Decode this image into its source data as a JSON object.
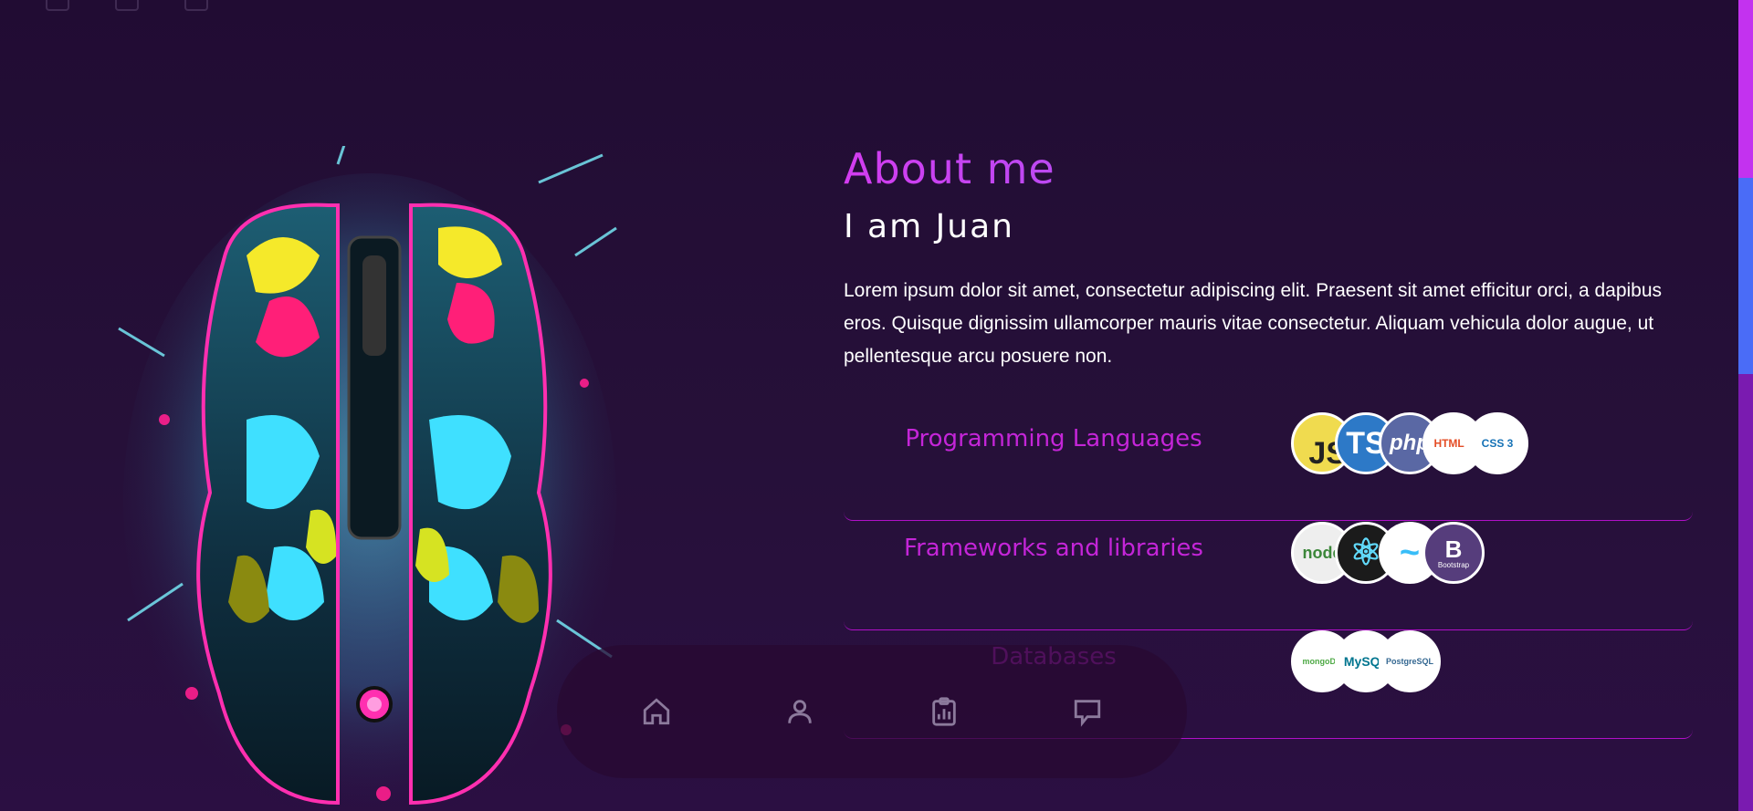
{
  "about": {
    "title": "About me",
    "subtitle": "I am Juan",
    "text": "Lorem ipsum dolor sit amet, consectetur adipiscing elit. Praesent sit amet efficitur orci, a dapibus eros. Quisque dignissim ullamcorper mauris vitae consectetur. Aliquam vehicula dolor augue, ut pellentesque arcu posuere non."
  },
  "skills": [
    {
      "label": "Programming Languages",
      "logos": [
        {
          "name": "javascript",
          "text": "JS",
          "bg": "#f0db4f",
          "fg": "#222"
        },
        {
          "name": "typescript",
          "text": "TS",
          "bg": "#2d79c7",
          "fg": "#fff"
        },
        {
          "name": "php",
          "text": "php",
          "bg": "#5a68a4",
          "fg": "#fff"
        },
        {
          "name": "html5",
          "text": "HTML 5",
          "bg": "#ffffff",
          "fg": "#e44d26"
        },
        {
          "name": "css3",
          "text": "CSS 3",
          "bg": "#ffffff",
          "fg": "#1572b6"
        }
      ]
    },
    {
      "label": "Frameworks and libraries",
      "logos": [
        {
          "name": "nodejs",
          "text": "node",
          "bg": "#eeeeee",
          "fg": "#3c873a"
        },
        {
          "name": "react",
          "text": "⚛",
          "bg": "#1b1b1b",
          "fg": "#61dafb"
        },
        {
          "name": "tailwind",
          "text": "~",
          "bg": "#ffffff",
          "fg": "#38bdf8"
        },
        {
          "name": "bootstrap",
          "text": "B",
          "bg": "#563d7c",
          "fg": "#fff",
          "caption": "Bootstrap"
        }
      ]
    },
    {
      "label": "Databases",
      "logos": [
        {
          "name": "mongodb",
          "text": "mongoDB",
          "bg": "#ffffff",
          "fg": "#4da944"
        },
        {
          "name": "mysql",
          "text": "MySQL",
          "bg": "#ffffff",
          "fg": "#00758f"
        },
        {
          "name": "postgresql",
          "text": "PostgreSQL",
          "bg": "#ffffff",
          "fg": "#336791"
        }
      ]
    }
  ],
  "nav": [
    {
      "name": "home-icon"
    },
    {
      "name": "user-icon"
    },
    {
      "name": "clipboard-chart-icon"
    },
    {
      "name": "chat-icon"
    }
  ]
}
